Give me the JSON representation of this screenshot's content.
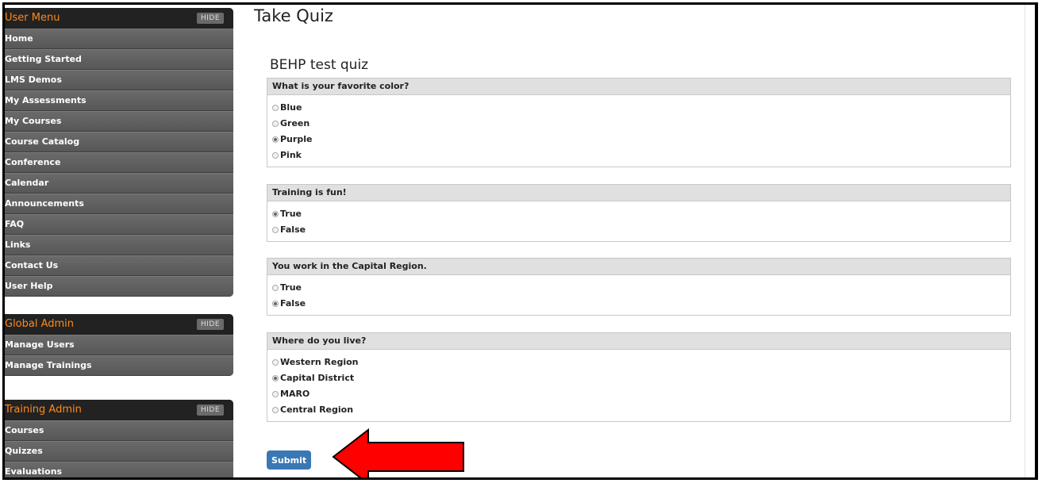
{
  "sidebar": {
    "user_menu": {
      "title": "User Menu",
      "hide": "HIDE",
      "items": [
        "Home",
        "Getting Started",
        "LMS Demos",
        "My Assessments",
        "My Courses",
        "Course Catalog",
        "Conference",
        "Calendar",
        "Announcements",
        "FAQ",
        "Links",
        "Contact Us",
        "User Help"
      ]
    },
    "global_admin": {
      "title": "Global Admin",
      "hide": "HIDE",
      "items": [
        "Manage Users",
        "Manage Trainings"
      ]
    },
    "training_admin": {
      "title": "Training Admin",
      "hide": "HIDE",
      "items": [
        "Courses",
        "Quizzes",
        "Evaluations"
      ]
    }
  },
  "main": {
    "page_title": "Take Quiz",
    "quiz_title": "BEHP test quiz",
    "questions": [
      {
        "text": "What is your favorite color?",
        "options": [
          "Blue",
          "Green",
          "Purple",
          "Pink"
        ],
        "selected": 2
      },
      {
        "text": "Training is fun!",
        "options": [
          "True",
          "False"
        ],
        "selected": 0
      },
      {
        "text": "You work in the Capital Region.",
        "options": [
          "True",
          "False"
        ],
        "selected": 1
      },
      {
        "text": "Where do you live?",
        "options": [
          "Western Region",
          "Capital District",
          "MARO",
          "Central Region"
        ],
        "selected": 1
      }
    ],
    "submit_label": "Submit"
  },
  "colors": {
    "menu_header_text": "#ff8a1c",
    "submit_bg": "#3a78b5",
    "arrow": "#ff0000"
  }
}
